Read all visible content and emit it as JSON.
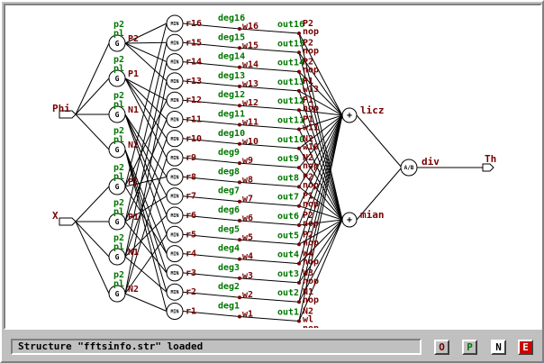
{
  "colors": {
    "node_fill": "#ffffff",
    "node_stroke": "#000000",
    "label_green": "#007700",
    "label_darkred": "#770000",
    "wire": "#000000",
    "canvas_bg": "#ffffff",
    "panel_bg": "#c0c0c0",
    "button_red_bg": "#cc0000",
    "button_green_text": "#007700"
  },
  "inputs": {
    "phi": "Phi",
    "x": "X"
  },
  "g_nodes": {
    "symbol": "G",
    "items": [
      {
        "top_label": "p2",
        "bottom_label": "pl",
        "side_label": "P2"
      },
      {
        "top_label": "p2",
        "bottom_label": "pl",
        "side_label": "P1"
      },
      {
        "top_label": "p2",
        "bottom_label": "pl",
        "side_label": "N1"
      },
      {
        "top_label": "p2",
        "bottom_label": "pl",
        "side_label": "N2"
      },
      {
        "top_label": "p2",
        "bottom_label": "pl",
        "side_label": "P2"
      },
      {
        "top_label": "p2",
        "bottom_label": "pl",
        "side_label": "P1"
      },
      {
        "top_label": "p2",
        "bottom_label": "pl",
        "side_label": "N1"
      },
      {
        "top_label": "p2",
        "bottom_label": "pl",
        "side_label": "N2"
      }
    ]
  },
  "min_nodes": {
    "symbol": "MIN",
    "labels": [
      "r16",
      "r15",
      "r14",
      "r13",
      "r12",
      "r11",
      "r10",
      "r9",
      "r8",
      "r7",
      "r6",
      "r5",
      "r4",
      "r3",
      "r2",
      "r1"
    ]
  },
  "rules": {
    "deg": [
      "deg16",
      "deg15",
      "deg14",
      "deg13",
      "deg12",
      "deg11",
      "deg10",
      "deg9",
      "deg8",
      "deg7",
      "deg6",
      "deg5",
      "deg4",
      "deg3",
      "deg2",
      "deg1"
    ],
    "w": [
      "w16",
      "w15",
      "w14",
      "w13",
      "w12",
      "w11",
      "w10",
      "w9",
      "w8",
      "w7",
      "w6",
      "w5",
      "w4",
      "w3",
      "w2",
      "w1"
    ],
    "out": [
      "out16",
      "out15",
      "out14",
      "out13",
      "out12",
      "out11",
      "out10",
      "out9",
      "out8",
      "out7",
      "out6",
      "out5",
      "out4",
      "out3",
      "out2",
      "out1"
    ],
    "right_top": [
      "P2",
      "P2",
      "P2",
      "P1",
      "P1",
      "P1",
      "N2",
      "N2",
      "P2",
      "P1",
      "P2",
      "P2",
      "W4",
      "W3",
      "N1",
      "N2"
    ],
    "right_bot": [
      "nop",
      "nop",
      "nop",
      "w13",
      "nop",
      "w11",
      "w10",
      "nop",
      "nop",
      "nop",
      "nop",
      "nop",
      "nop",
      "nop",
      "nop",
      "wl"
    ],
    "last_nop": "nop"
  },
  "sum_nodes": {
    "symbol": "+",
    "top_label": "licz",
    "bottom_label": "mian"
  },
  "div_node": {
    "symbol": "A/B",
    "label": "div"
  },
  "output": {
    "label": "Th"
  },
  "status": {
    "message": "Structure \"fftsinfo.str\" loaded"
  },
  "toolbar": {
    "buttons": [
      {
        "label": "O"
      },
      {
        "label": "P"
      },
      {
        "label": "N"
      },
      {
        "label": "E"
      }
    ]
  }
}
